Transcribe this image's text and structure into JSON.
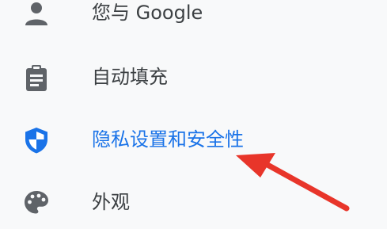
{
  "menu": {
    "items": [
      {
        "label": "您与 Google",
        "icon": "person-icon"
      },
      {
        "label": "自动填充",
        "icon": "clipboard-icon"
      },
      {
        "label": "隐私设置和安全性",
        "icon": "shield-icon",
        "selected": true
      },
      {
        "label": "外观",
        "icon": "palette-icon"
      }
    ]
  },
  "colors": {
    "background": "#f8f9fa",
    "text": "#3c4043",
    "icon": "#5f6368",
    "accent": "#1a73e8",
    "arrow": "#e8352a"
  }
}
